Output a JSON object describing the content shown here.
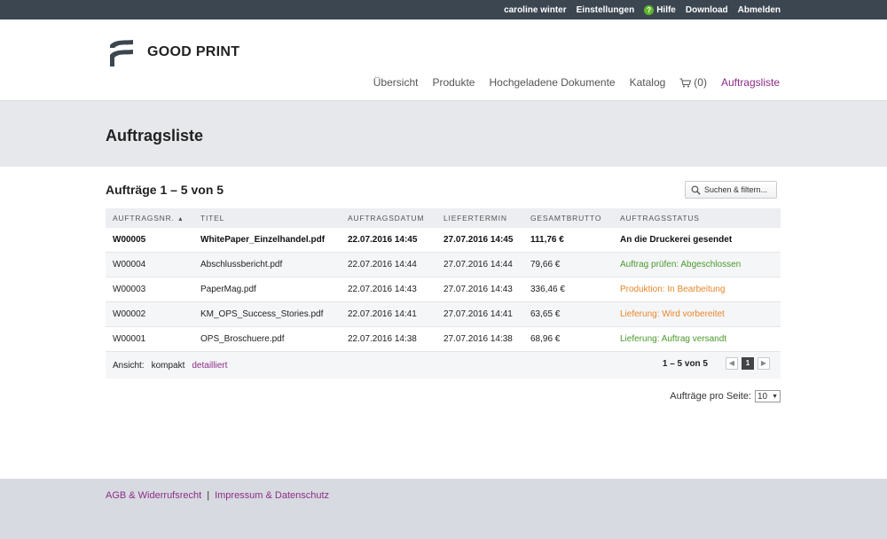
{
  "topbar": {
    "user": "caroline winter",
    "settings": "Einstellungen",
    "help": "Hilfe",
    "download": "Download",
    "logout": "Abmelden"
  },
  "brand": {
    "name": "GOOD PRINT"
  },
  "nav": {
    "overview": "Übersicht",
    "products": "Produkte",
    "uploaded": "Hochgeladene Dokumente",
    "catalog": "Katalog",
    "cart": "(0)",
    "orders": "Auftragsliste"
  },
  "page": {
    "title": "Auftragsliste"
  },
  "list": {
    "count_title": "Aufträge 1 – 5 von 5",
    "filter_button": "Suchen & filtern...",
    "columns": [
      "AUFTRAGSNR.",
      "TITEL",
      "AUFTRAGSDATUM",
      "LIEFERTERMIN",
      "GESAMTBRUTTO",
      "AUFTRAGSSTATUS"
    ],
    "sort_indicator": "▲",
    "rows": [
      {
        "nr": "W00005",
        "title": "WhitePaper_Einzelhandel.pdf",
        "date": "22.07.2016 14:45",
        "delivery": "27.07.2016 14:45",
        "total": "111,76 €",
        "status": "An die Druckerei gesendet"
      },
      {
        "nr": "W00004",
        "title": "Abschlussbericht.pdf",
        "date": "22.07.2016 14:44",
        "delivery": "27.07.2016 14:44",
        "total": "79,66 €",
        "status": "Auftrag prüfen: Abgeschlossen"
      },
      {
        "nr": "W00003",
        "title": "PaperMag.pdf",
        "date": "22.07.2016 14:43",
        "delivery": "27.07.2016 14:43",
        "total": "336,46 €",
        "status": "Produktion: In Bearbeitung"
      },
      {
        "nr": "W00002",
        "title": "KM_OPS_Success_Stories.pdf",
        "date": "22.07.2016 14:41",
        "delivery": "27.07.2016 14:41",
        "total": "63,65 €",
        "status": "Lieferung: Wird vorbereitet"
      },
      {
        "nr": "W00001",
        "title": "OPS_Broschuere.pdf",
        "date": "22.07.2016 14:38",
        "delivery": "27.07.2016 14:38",
        "total": "68,96 €",
        "status": "Lieferung: Auftrag versandt"
      }
    ],
    "view_label": "Ansicht:",
    "view_compact": "kompakt",
    "view_detailed": "detailliert",
    "pager_range": "1 – 5 von 5",
    "pager_prev": "◀",
    "pager_current": "1",
    "pager_next": "▶",
    "per_page_label": "Aufträge pro Seite:",
    "per_page_value": "10"
  },
  "footer": {
    "terms": "AGB & Widerrufsrecht",
    "separator": "|",
    "imprint": "Impressum & Datenschutz"
  },
  "colors": {
    "accent": "#8b2d87",
    "status_green": "#4a9a2b",
    "status_orange": "#e8852a",
    "topbar": "#3b4650"
  }
}
